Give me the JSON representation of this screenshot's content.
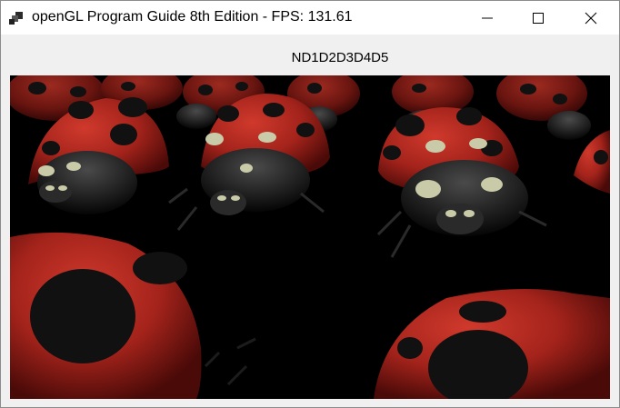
{
  "window": {
    "title": "openGL Program Guide 8th Edition - FPS: 131.61",
    "app_icon": "app-cubes-icon",
    "controls": [
      "minimize-icon",
      "maximize-icon",
      "close-icon"
    ]
  },
  "status": {
    "label": "ND1D2D3D4D5"
  },
  "scene": {
    "description_icon": "ladybug-scene",
    "colors": {
      "shell": "#a3231b",
      "shell_dark": "#5a0d0a",
      "spot": "#111111",
      "body": "#1a1a1a",
      "pale_spot": "#c9cba8"
    }
  }
}
